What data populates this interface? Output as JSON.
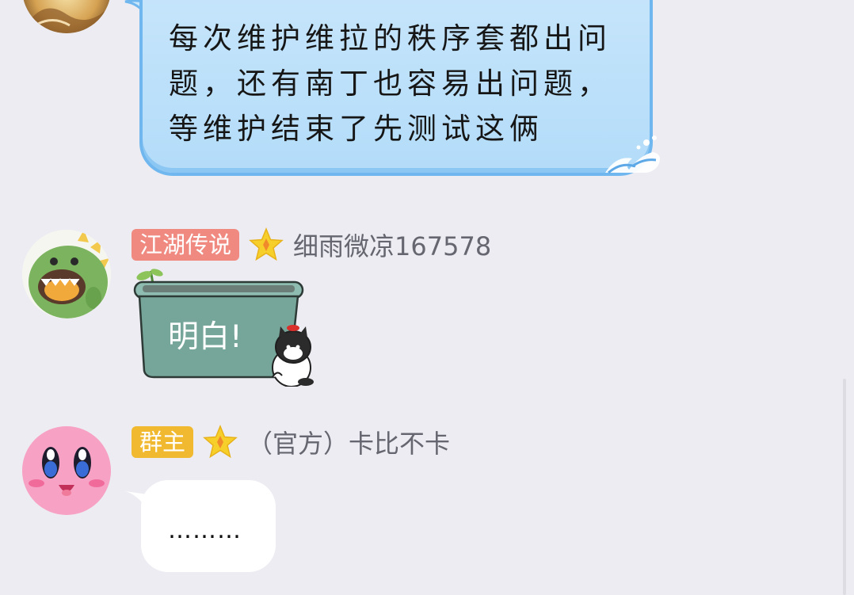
{
  "messages": [
    {
      "avatar_icon": "golden-character-avatar-icon",
      "text": "每次维护维拉的秩序套都出问\n题，还有南丁也容易出问题，\n等维护结束了先测试这俩",
      "bubble_theme": "blue-wave"
    },
    {
      "avatar_icon": "green-dinosaur-avatar-icon",
      "badge": "江湖传说",
      "badge_color": "#f08a80",
      "star_icon": "star-icon",
      "sender": "细雨微凉167578",
      "text": "明白!",
      "bubble_theme": "green-pot-with-cat"
    },
    {
      "avatar_icon": "pink-kirby-avatar-icon",
      "badge": "群主",
      "badge_color": "#f0b930",
      "star_icon": "star-icon",
      "sender": "（官方）卡比不卡",
      "text": "………",
      "bubble_theme": "plain-white"
    }
  ],
  "colors": {
    "background": "#ececf2",
    "bubble_blue": "#b9dffa",
    "bubble_border_blue": "#6fb7ee",
    "pot_green": "#76a69a",
    "name_gray": "#666670"
  }
}
